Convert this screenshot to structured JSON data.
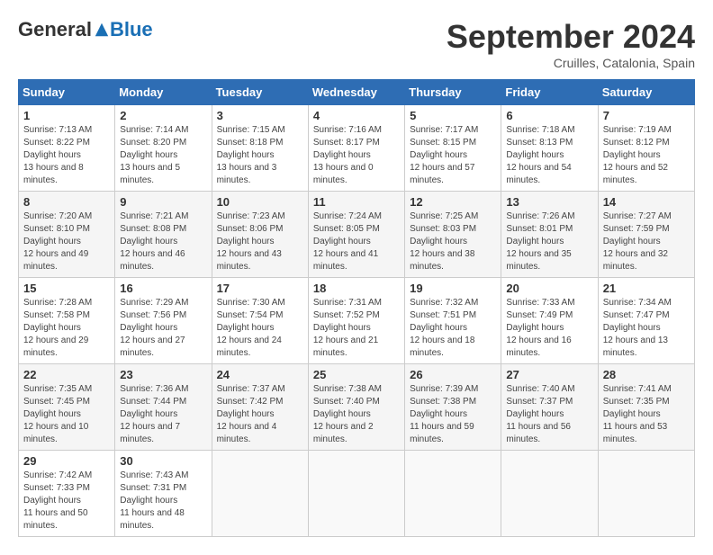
{
  "header": {
    "logo_general": "General",
    "logo_blue": "Blue",
    "month_title": "September 2024",
    "location": "Cruilles, Catalonia, Spain"
  },
  "weekdays": [
    "Sunday",
    "Monday",
    "Tuesday",
    "Wednesday",
    "Thursday",
    "Friday",
    "Saturday"
  ],
  "weeks": [
    [
      {
        "day": "1",
        "sunrise": "7:13 AM",
        "sunset": "8:22 PM",
        "daylight": "13 hours and 8 minutes."
      },
      {
        "day": "2",
        "sunrise": "7:14 AM",
        "sunset": "8:20 PM",
        "daylight": "13 hours and 5 minutes."
      },
      {
        "day": "3",
        "sunrise": "7:15 AM",
        "sunset": "8:18 PM",
        "daylight": "13 hours and 3 minutes."
      },
      {
        "day": "4",
        "sunrise": "7:16 AM",
        "sunset": "8:17 PM",
        "daylight": "13 hours and 0 minutes."
      },
      {
        "day": "5",
        "sunrise": "7:17 AM",
        "sunset": "8:15 PM",
        "daylight": "12 hours and 57 minutes."
      },
      {
        "day": "6",
        "sunrise": "7:18 AM",
        "sunset": "8:13 PM",
        "daylight": "12 hours and 54 minutes."
      },
      {
        "day": "7",
        "sunrise": "7:19 AM",
        "sunset": "8:12 PM",
        "daylight": "12 hours and 52 minutes."
      }
    ],
    [
      {
        "day": "8",
        "sunrise": "7:20 AM",
        "sunset": "8:10 PM",
        "daylight": "12 hours and 49 minutes."
      },
      {
        "day": "9",
        "sunrise": "7:21 AM",
        "sunset": "8:08 PM",
        "daylight": "12 hours and 46 minutes."
      },
      {
        "day": "10",
        "sunrise": "7:23 AM",
        "sunset": "8:06 PM",
        "daylight": "12 hours and 43 minutes."
      },
      {
        "day": "11",
        "sunrise": "7:24 AM",
        "sunset": "8:05 PM",
        "daylight": "12 hours and 41 minutes."
      },
      {
        "day": "12",
        "sunrise": "7:25 AM",
        "sunset": "8:03 PM",
        "daylight": "12 hours and 38 minutes."
      },
      {
        "day": "13",
        "sunrise": "7:26 AM",
        "sunset": "8:01 PM",
        "daylight": "12 hours and 35 minutes."
      },
      {
        "day": "14",
        "sunrise": "7:27 AM",
        "sunset": "7:59 PM",
        "daylight": "12 hours and 32 minutes."
      }
    ],
    [
      {
        "day": "15",
        "sunrise": "7:28 AM",
        "sunset": "7:58 PM",
        "daylight": "12 hours and 29 minutes."
      },
      {
        "day": "16",
        "sunrise": "7:29 AM",
        "sunset": "7:56 PM",
        "daylight": "12 hours and 27 minutes."
      },
      {
        "day": "17",
        "sunrise": "7:30 AM",
        "sunset": "7:54 PM",
        "daylight": "12 hours and 24 minutes."
      },
      {
        "day": "18",
        "sunrise": "7:31 AM",
        "sunset": "7:52 PM",
        "daylight": "12 hours and 21 minutes."
      },
      {
        "day": "19",
        "sunrise": "7:32 AM",
        "sunset": "7:51 PM",
        "daylight": "12 hours and 18 minutes."
      },
      {
        "day": "20",
        "sunrise": "7:33 AM",
        "sunset": "7:49 PM",
        "daylight": "12 hours and 16 minutes."
      },
      {
        "day": "21",
        "sunrise": "7:34 AM",
        "sunset": "7:47 PM",
        "daylight": "12 hours and 13 minutes."
      }
    ],
    [
      {
        "day": "22",
        "sunrise": "7:35 AM",
        "sunset": "7:45 PM",
        "daylight": "12 hours and 10 minutes."
      },
      {
        "day": "23",
        "sunrise": "7:36 AM",
        "sunset": "7:44 PM",
        "daylight": "12 hours and 7 minutes."
      },
      {
        "day": "24",
        "sunrise": "7:37 AM",
        "sunset": "7:42 PM",
        "daylight": "12 hours and 4 minutes."
      },
      {
        "day": "25",
        "sunrise": "7:38 AM",
        "sunset": "7:40 PM",
        "daylight": "12 hours and 2 minutes."
      },
      {
        "day": "26",
        "sunrise": "7:39 AM",
        "sunset": "7:38 PM",
        "daylight": "11 hours and 59 minutes."
      },
      {
        "day": "27",
        "sunrise": "7:40 AM",
        "sunset": "7:37 PM",
        "daylight": "11 hours and 56 minutes."
      },
      {
        "day": "28",
        "sunrise": "7:41 AM",
        "sunset": "7:35 PM",
        "daylight": "11 hours and 53 minutes."
      }
    ],
    [
      {
        "day": "29",
        "sunrise": "7:42 AM",
        "sunset": "7:33 PM",
        "daylight": "11 hours and 50 minutes."
      },
      {
        "day": "30",
        "sunrise": "7:43 AM",
        "sunset": "7:31 PM",
        "daylight": "11 hours and 48 minutes."
      },
      null,
      null,
      null,
      null,
      null
    ]
  ]
}
